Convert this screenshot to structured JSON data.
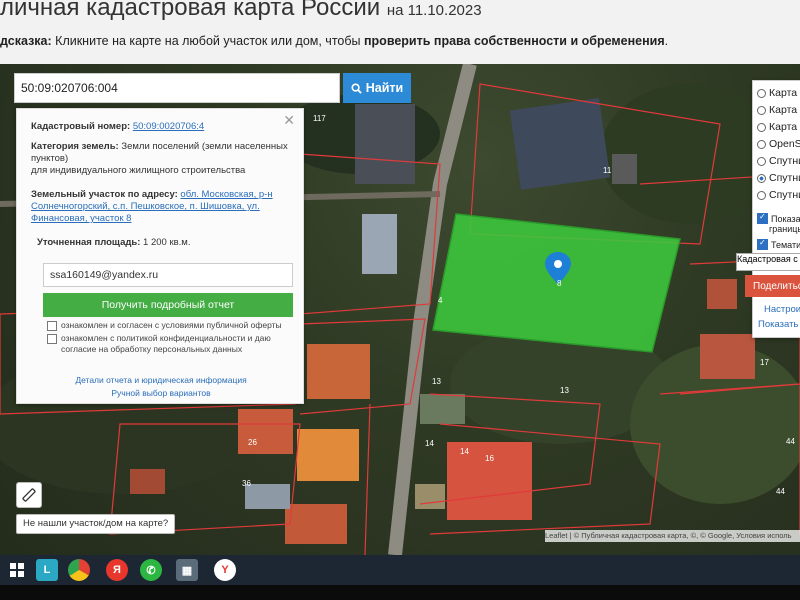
{
  "header": {
    "title": "личная кадастровая карта России",
    "date": "на 11.10.2023"
  },
  "hint": {
    "prefix": "дсказка:",
    "text": "Кликните на карте на любой участок или дом, чтобы",
    "bold": "проверить права собственности и обременения",
    "suffix": "."
  },
  "search": {
    "value": "50:09:020706:004",
    "button_label": "Найти",
    "icon": "search-icon"
  },
  "info_panel": {
    "cad_label": "Кадастровый номер:",
    "cad_value": "50:09:0020706:4",
    "cat_label": "Категория земель:",
    "cat_value": "Земли поселений (земли населенных пунктов)",
    "cat_use": "для индивидуального жилищного строительства",
    "addr_label": "Земельный участок по адресу:",
    "addr_value": "обл. Московская, р-н Солнечногорский, с.п. Пешковское, п. Шишовка, ул. Финансовая, участок 8",
    "area_label": "Уточненная площадь:",
    "area_value": "1 200 кв.м.",
    "email_value": "ssa160149@yandex.ru",
    "report_button": "Получить подробный отчет",
    "agree_offer": "ознакомлен и согласен с условиями публичной оферты",
    "agree_privacy": "ознакомлен с политикой конфиденциальности и даю согласие на обработку персональных данных",
    "details_link": "Детали отчета и юридическая информация",
    "manual_link": "Ручной выбор вариантов"
  },
  "layers": {
    "items": [
      {
        "label": "Карта",
        "selected": false
      },
      {
        "label": "Карта",
        "selected": false
      },
      {
        "label": "Карта",
        "selected": false
      },
      {
        "label": "OpenS",
        "selected": false
      },
      {
        "label": "Спутни",
        "selected": false
      },
      {
        "label": "Спутни",
        "selected": true
      },
      {
        "label": "Спутни",
        "selected": false
      }
    ],
    "check_borders": "Показать",
    "check_borders_sub": "границы у",
    "check_thematic": "Тематичес",
    "select_value": "Кадастровая с",
    "share_button": "Поделитьс",
    "settings_link": "Настроить",
    "show_link": "Показать л"
  },
  "map": {
    "plot_numbers": [
      "117",
      "11",
      "4",
      "8",
      "17",
      "13",
      "13",
      "14",
      "14",
      "16",
      "26",
      "36",
      "44",
      "44"
    ],
    "selected_plot_color": "#3cc83c",
    "not_found_label": "Не нашли участок/дом на карте?",
    "attribution": "Leaflet | © Публичная кадастровая карта, ©, © Google, Условия исполь"
  },
  "taskbar": {
    "icons": [
      "windows-icon",
      "l-app-icon",
      "chrome-icon",
      "yandex-icon",
      "whatsapp-icon",
      "calculator-icon",
      "yandex-browser-icon"
    ]
  }
}
